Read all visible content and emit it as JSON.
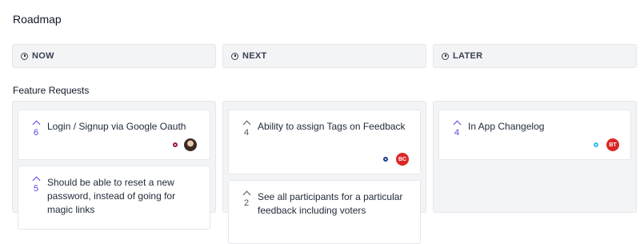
{
  "page_title": "Roadmap",
  "phases": [
    {
      "label": "NOW",
      "icon": "clock-icon"
    },
    {
      "label": "NEXT",
      "icon": "clock-icon"
    },
    {
      "label": "LATER",
      "icon": "clock-icon"
    }
  ],
  "section_title": "Feature Requests",
  "columns": [
    {
      "cards": [
        {
          "title": "Login / Signup via Google Oauth",
          "votes": "6",
          "status_color": "#9d174d",
          "avatar": "photo"
        },
        {
          "title": "Should be able to reset a new password, instead of going for magic links",
          "votes": "5"
        }
      ]
    },
    {
      "cards": [
        {
          "title": "Ability to assign Tags on Feedback",
          "votes": "4",
          "status_color": "#1e3a8a",
          "avatar_initials": "BC"
        },
        {
          "title": "See all participants for a particular feedback including voters",
          "votes": "2"
        }
      ]
    },
    {
      "cards": [
        {
          "title": "In App Changelog",
          "votes": "4",
          "status_color": "#38bdf8",
          "avatar_initials": "BT"
        }
      ]
    }
  ],
  "colors": {
    "accent": "#4f46e5",
    "avatar_red": "#dc2626"
  }
}
